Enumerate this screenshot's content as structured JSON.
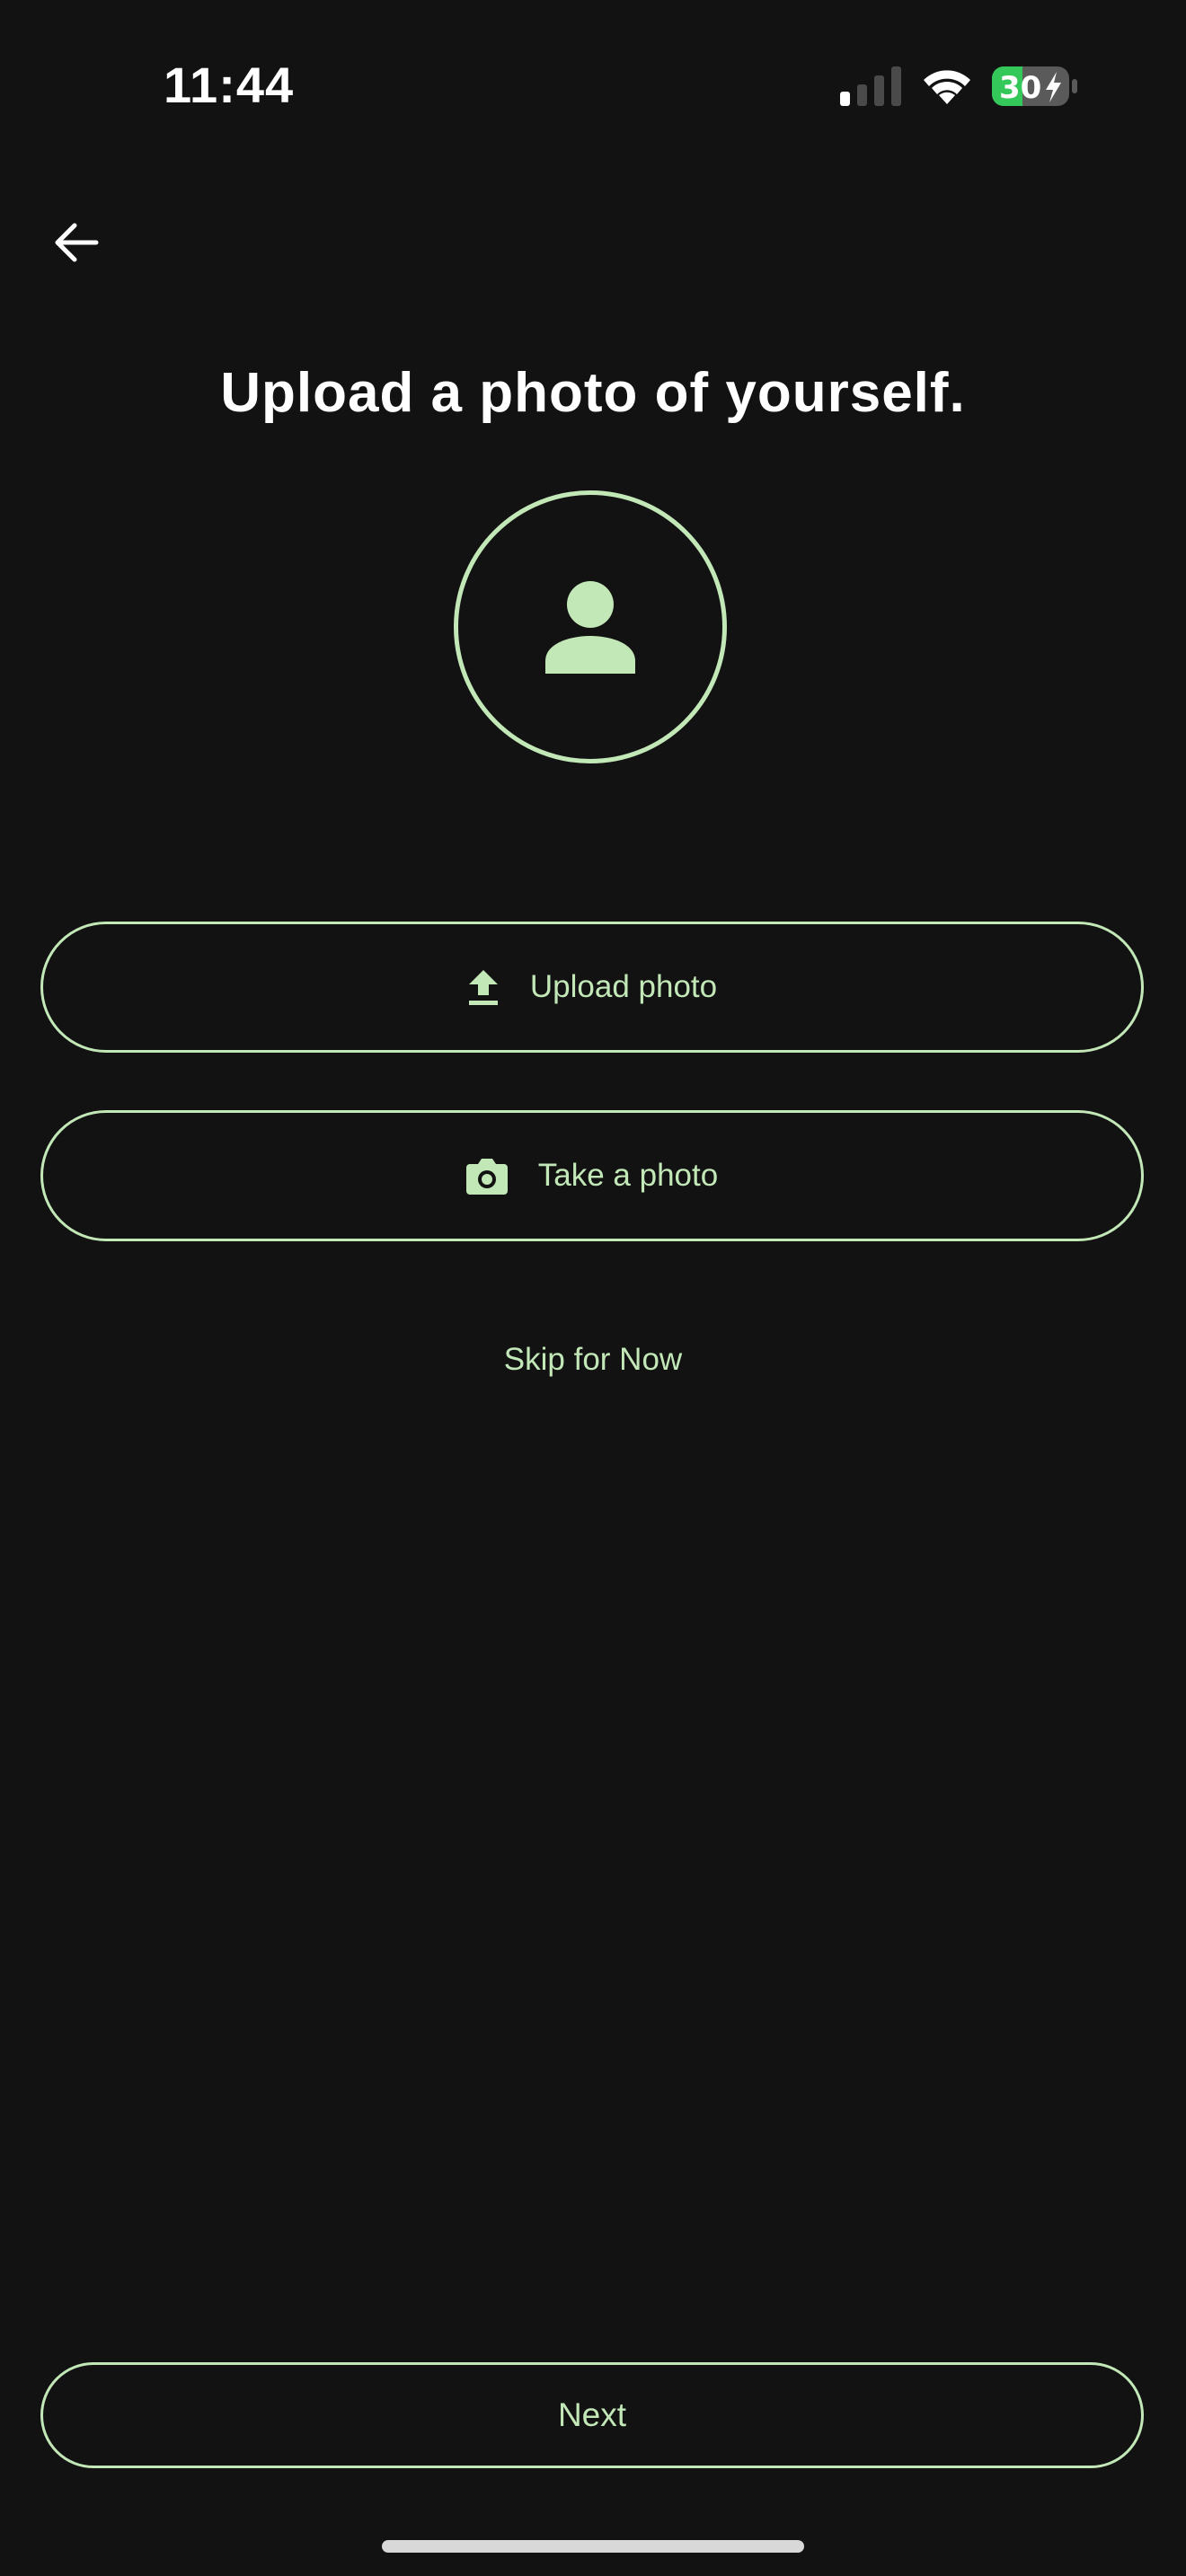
{
  "status_bar": {
    "time": "11:44",
    "battery_level": "30",
    "icons": [
      "signal-icon",
      "wifi-icon",
      "battery-charging-icon"
    ]
  },
  "header": {
    "back_icon": "arrow-left-icon"
  },
  "main": {
    "title": "Upload a photo of yourself.",
    "avatar_icon": "person-icon",
    "upload_button": {
      "label": "Upload photo",
      "icon": "upload-icon"
    },
    "take_photo_button": {
      "label": "Take a photo",
      "icon": "camera-icon"
    },
    "skip_label": "Skip for Now"
  },
  "footer": {
    "next_label": "Next"
  },
  "colors": {
    "background": "#121212",
    "accent": "#c3e8b8",
    "text": "#ffffff",
    "battery_fill": "#34c759"
  }
}
